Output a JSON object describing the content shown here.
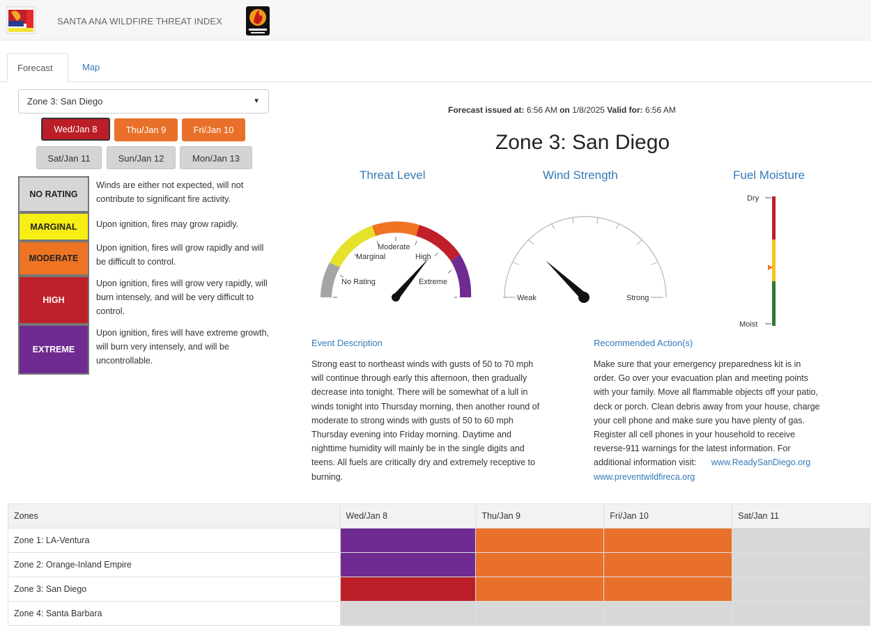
{
  "app": {
    "title": "SANTA ANA WILDFIRE THREAT INDEX"
  },
  "tabs": [
    {
      "label": "Forecast",
      "active": true
    },
    {
      "label": "Map",
      "active": false
    }
  ],
  "zone_select": {
    "value": "Zone 3: San Diego",
    "arrow": "▼"
  },
  "days": [
    {
      "label": "Wed/Jan 8",
      "color": "#bb1e27",
      "selected": true
    },
    {
      "label": "Thu/Jan 9",
      "color": "#e9702a"
    },
    {
      "label": "Fri/Jan 10",
      "color": "#e9702a"
    },
    {
      "label": "Sat/Jan 11",
      "color": "#d4d4d4"
    },
    {
      "label": "Sun/Jan 12",
      "color": "#d4d4d4"
    },
    {
      "label": "Mon/Jan 13",
      "color": "#d4d4d4"
    }
  ],
  "legend": [
    {
      "label": "NO RATING",
      "color": "#d6d6d6",
      "desc": "Winds are either not expected, will not contribute to significant fire activity."
    },
    {
      "label": "MARGINAL",
      "color": "#f7ee14",
      "desc": "Upon ignition, fires may grow rapidly."
    },
    {
      "label": "MODERATE",
      "color": "#ee7424",
      "desc": "Upon ignition, fires will grow rapidly and will be difficult to control."
    },
    {
      "label": "HIGH",
      "color": "#c0202a",
      "desc": "Upon ignition, fires will grow very rapidly, will burn intensely, and will be very difficult to control."
    },
    {
      "label": "EXTREME",
      "color": "#6f2b91",
      "desc": "Upon ignition, fires will have extreme growth, will burn very intensely, and will be uncontrollable."
    }
  ],
  "forecast": {
    "issued_label": "Forecast issued at:",
    "issued_time": "6:56 AM",
    "on_label": "on",
    "date": "1/8/2025",
    "valid_label": "Valid for:",
    "valid_time": "6:56 AM",
    "zone_title": "Zone 3: San Diego"
  },
  "gauges": {
    "threat": {
      "title": "Threat Level",
      "labels": [
        "No Rating",
        "Marginal",
        "Moderate",
        "High",
        "Extreme"
      ]
    },
    "wind": {
      "title": "Wind Strength",
      "min_label": "Weak",
      "max_label": "Strong"
    },
    "fuel": {
      "title": "Fuel Moisture",
      "top_label": "Dry",
      "bottom_label": "Moist"
    }
  },
  "event": {
    "title": "Event Description",
    "lines": [
      "Strong east to northeast winds with gusts of 50 to 70 mph",
      "will continue through early this afternoon, then gradually",
      "decrease into tonight. There will be somewhat of a lull in",
      "winds tonight into Thursday morning, then another round of",
      "moderate to strong winds with gusts of 50 to 60 mph",
      "Thursday evening into Friday morning. Daytime and",
      "nighttime humidity will mainly be in the single digits and",
      "teens. All fuels are critically dry and extremely receptive to",
      "burning."
    ]
  },
  "actions": {
    "title": "Recommended Action(s)",
    "lines": [
      "Make sure that your emergency preparedness kit is in",
      "order. Go over your evacuation plan and meeting points",
      "with your family. Move all flammable objects off your patio,",
      "deck or porch. Clean debris away from your house, charge",
      "your cell phone and make sure you have plenty of gas.",
      "Register all cell phones in your household to receive",
      "reverse-911 warnings for the latest information. For",
      "additional information visit:"
    ],
    "link1": "www.ReadySanDiego.org",
    "link2": "www.preventwildfireca.org"
  },
  "table": {
    "headers": [
      "Zones",
      "Wed/Jan 8",
      "Thu/Jan 9",
      "Fri/Jan 10",
      "Sat/Jan 11"
    ],
    "rows": [
      {
        "zone": "Zone 1: LA-Ventura",
        "levels": [
          "EXTREME",
          "MODERATE",
          "MODERATE",
          "NO RATING"
        ]
      },
      {
        "zone": "Zone 2: Orange-Inland Empire",
        "levels": [
          "EXTREME",
          "MODERATE",
          "MODERATE",
          "NO RATING"
        ]
      },
      {
        "zone": "Zone 3: San Diego",
        "levels": [
          "HIGH",
          "MODERATE",
          "MODERATE",
          "NO RATING"
        ]
      },
      {
        "zone": "Zone 4: Santa Barbara",
        "levels": [
          "NO RATING",
          "NO RATING",
          "NO RATING",
          "NO RATING"
        ]
      }
    ]
  },
  "icons": [
    "flag-logo-icon",
    "fire-logo-icon",
    "chevron-down-icon"
  ]
}
